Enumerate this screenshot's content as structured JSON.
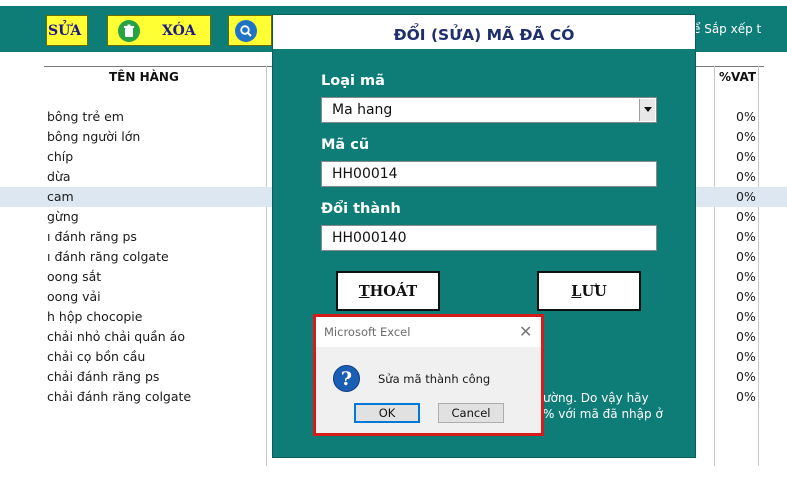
{
  "toolbar": {
    "sua_label": "SỬA",
    "xoa_label": "XÓA",
    "sapxep_label": "ể Sắp xếp t"
  },
  "sheet": {
    "col_ten_hang": "TÊN HÀNG",
    "col_vat": "%VAT",
    "rows": [
      {
        "name": "bông trẻ em",
        "vat": "0%"
      },
      {
        "name": "bông người lớn",
        "vat": "0%"
      },
      {
        "name": "chíp",
        "vat": "0%"
      },
      {
        "name": "dừa",
        "vat": "0%"
      },
      {
        "name": "cam",
        "vat": "0%"
      },
      {
        "name": "gừng",
        "vat": "0%"
      },
      {
        "name": "ı đánh răng ps",
        "vat": "0%"
      },
      {
        "name": "ı đánh răng colgate",
        "vat": "0%"
      },
      {
        "name": "oong sắt",
        "vat": "0%"
      },
      {
        "name": "oong vải",
        "vat": "0%"
      },
      {
        "name": "h hộp chocopie",
        "vat": "0%"
      },
      {
        "name": "chải nhỏ chải quần áo",
        "vat": "0%"
      },
      {
        "name": "chải cọ bồn cầu",
        "vat": "0%"
      },
      {
        "name": "chải đánh răng ps",
        "vat": "0%"
      },
      {
        "name": "chải đánh răng colgate",
        "vat": "0%"
      }
    ]
  },
  "form": {
    "title": "ĐỔI (SỬA) MÃ ĐÃ CÓ",
    "loai_ma_label": "Loại mã",
    "loai_ma_value": "Ma hang",
    "ma_cu_label": "Mã cũ",
    "ma_cu_value": "HH00014",
    "doi_thanh_label": "Đổi thành",
    "doi_thanh_value": "HH000140",
    "thoat_first": "T",
    "thoat_rest": "HOÁT",
    "luu_first": "L",
    "luu_rest": "ƯU",
    "note_line1": "ường. Do vậy hãy",
    "note_line2": "% với mã đã nhập ở"
  },
  "msgbox": {
    "title": "Microsoft Excel",
    "close": "✕",
    "icon": "?",
    "text": "Sửa mã thành công",
    "ok": "OK",
    "cancel": "Cancel"
  },
  "colors": {
    "teal": "#0e7d78",
    "yellow": "#ffff33",
    "highlight_red": "#d61b1b"
  }
}
